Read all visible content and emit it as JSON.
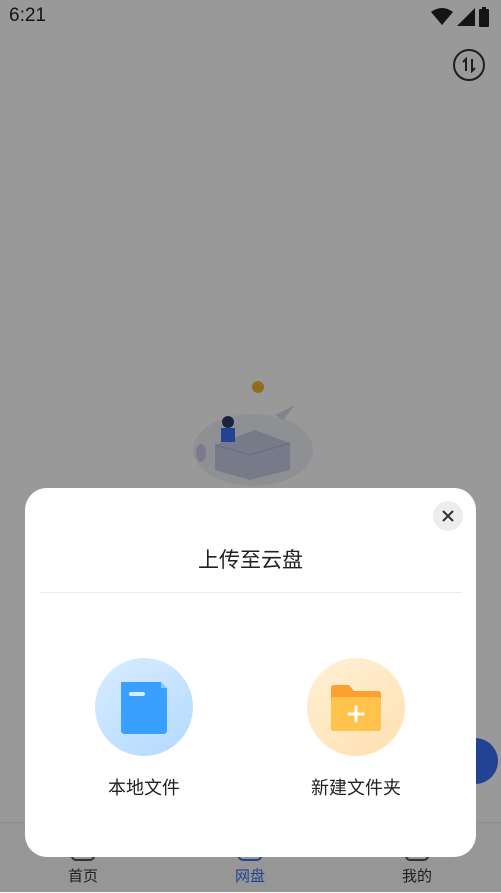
{
  "status_bar": {
    "time": "6:21"
  },
  "tabs": [
    {
      "label": "首页",
      "active": false
    },
    {
      "label": "网盘",
      "active": true
    },
    {
      "label": "我的",
      "active": false
    }
  ],
  "modal": {
    "title": "上传至云盘",
    "options": [
      {
        "label": "本地文件",
        "icon": "document-icon"
      },
      {
        "label": "新建文件夹",
        "icon": "new-folder-icon"
      }
    ]
  },
  "colors": {
    "accent": "#3d6ef5",
    "overlay": "rgba(0,0,0,0.40)"
  }
}
